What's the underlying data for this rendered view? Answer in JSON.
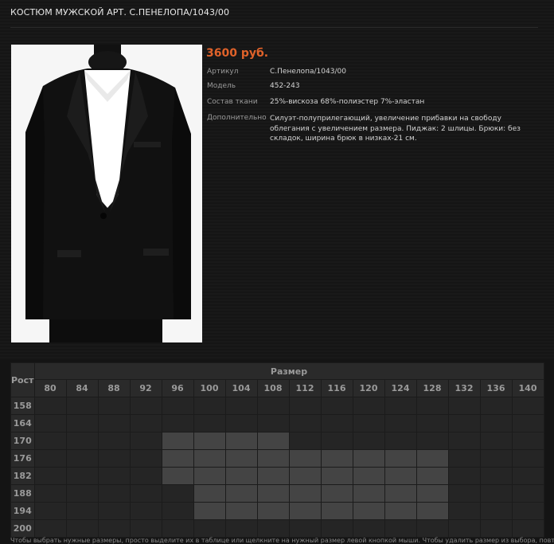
{
  "page": {
    "title": "КОСТЮМ МУЖСКОЙ АРТ. С.ПЕНЕЛОПА/1043/00"
  },
  "product": {
    "price": "3600 руб.",
    "photo": "black-suit-on-mannequin",
    "specs": [
      {
        "label": "Артикул",
        "value": "С.Пенелопа/1043/00"
      },
      {
        "label": "Модель",
        "value": "452-243"
      },
      {
        "label": "Состав ткани",
        "value": "25%-вискоза 68%-полиэстер 7%-эластан"
      },
      {
        "label": "Дополнительно",
        "value": "Силуэт-полуприлегающий, увеличение прибавки на свободу облегания с увеличением размера. Пиджак: 2 шлицы. Брюки: без складок, ширина брюк в низках-21 см."
      }
    ]
  },
  "size_table": {
    "rost_label": "Рост",
    "razmer_label": "Размер",
    "sizes": [
      "80",
      "84",
      "88",
      "92",
      "96",
      "100",
      "104",
      "108",
      "112",
      "116",
      "120",
      "124",
      "128",
      "132",
      "136",
      "140"
    ],
    "heights": [
      "158",
      "164",
      "170",
      "176",
      "182",
      "188",
      "194",
      "200"
    ],
    "availability": [
      [
        0,
        0,
        0,
        0,
        0,
        0,
        0,
        0,
        0,
        0,
        0,
        0,
        0,
        0,
        0,
        0
      ],
      [
        0,
        0,
        0,
        0,
        0,
        0,
        0,
        0,
        0,
        0,
        0,
        0,
        0,
        0,
        0,
        0
      ],
      [
        0,
        0,
        0,
        0,
        1,
        1,
        1,
        1,
        0,
        0,
        0,
        0,
        0,
        0,
        0,
        0
      ],
      [
        0,
        0,
        0,
        0,
        1,
        1,
        1,
        1,
        1,
        1,
        1,
        1,
        1,
        0,
        0,
        0
      ],
      [
        0,
        0,
        0,
        0,
        1,
        1,
        1,
        1,
        1,
        1,
        1,
        1,
        1,
        0,
        0,
        0
      ],
      [
        0,
        0,
        0,
        0,
        0,
        1,
        1,
        1,
        1,
        1,
        1,
        1,
        1,
        0,
        0,
        0
      ],
      [
        0,
        0,
        0,
        0,
        0,
        1,
        1,
        1,
        1,
        1,
        1,
        1,
        1,
        0,
        0,
        0
      ],
      [
        0,
        0,
        0,
        0,
        0,
        0,
        0,
        0,
        0,
        0,
        0,
        0,
        0,
        0,
        0,
        0
      ]
    ],
    "colors": {
      "available": "#444444",
      "unavailable": "#252525"
    }
  },
  "footnote": "Чтобы выбрать нужные размеры, просто выделите их в таблице или щелкните на нужный размер левой кнопкой мыши. Чтобы удалить размер из выбора, повторно"
}
